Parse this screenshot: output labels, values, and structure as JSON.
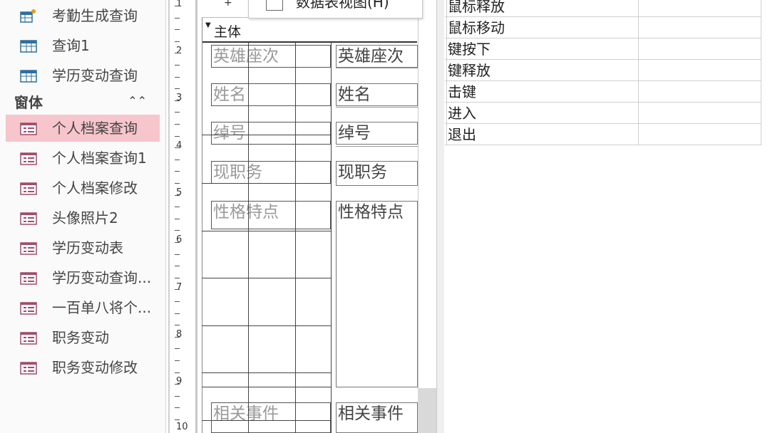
{
  "nav": {
    "queries": [
      {
        "label": "考勤生成查询",
        "icon": "query-icon"
      },
      {
        "label": "查询1",
        "icon": "query-icon"
      },
      {
        "label": "学历变动查询",
        "icon": "query-icon"
      }
    ],
    "group_header": "窗体",
    "forms": [
      {
        "label": "个人档案查询",
        "selected": true
      },
      {
        "label": "个人档案查询1"
      },
      {
        "label": "个人档案修改"
      },
      {
        "label": "头像照片2"
      },
      {
        "label": "学历变动表"
      },
      {
        "label": "学历变动查询..."
      },
      {
        "label": "一百单八将个..."
      },
      {
        "label": "职务变动"
      },
      {
        "label": "职务变动修改"
      }
    ]
  },
  "ruler": {
    "numbers": [
      "1",
      "2",
      "3",
      "4",
      "5",
      "6",
      "7",
      "8",
      "9",
      "10"
    ]
  },
  "popup": {
    "label": "数据表视图(H)"
  },
  "form": {
    "section": "主体",
    "labels": [
      "英雄座次",
      "姓名",
      "绰号",
      "现职务",
      "性格特点",
      "相关事件"
    ],
    "fields": [
      "英雄座次",
      "姓名",
      "绰号",
      "现职务",
      "性格特点",
      "相关事件"
    ]
  },
  "properties": {
    "rows": [
      {
        "name": "鼠标释放"
      },
      {
        "name": "鼠标移动"
      },
      {
        "name": "键按下"
      },
      {
        "name": "键释放"
      },
      {
        "name": "击键"
      },
      {
        "name": "进入"
      },
      {
        "name": "退出"
      }
    ]
  },
  "colors": {
    "selected": "#f7c5cc",
    "form_icon": "#a04d6b",
    "query_icon": "#2e6f9e"
  }
}
